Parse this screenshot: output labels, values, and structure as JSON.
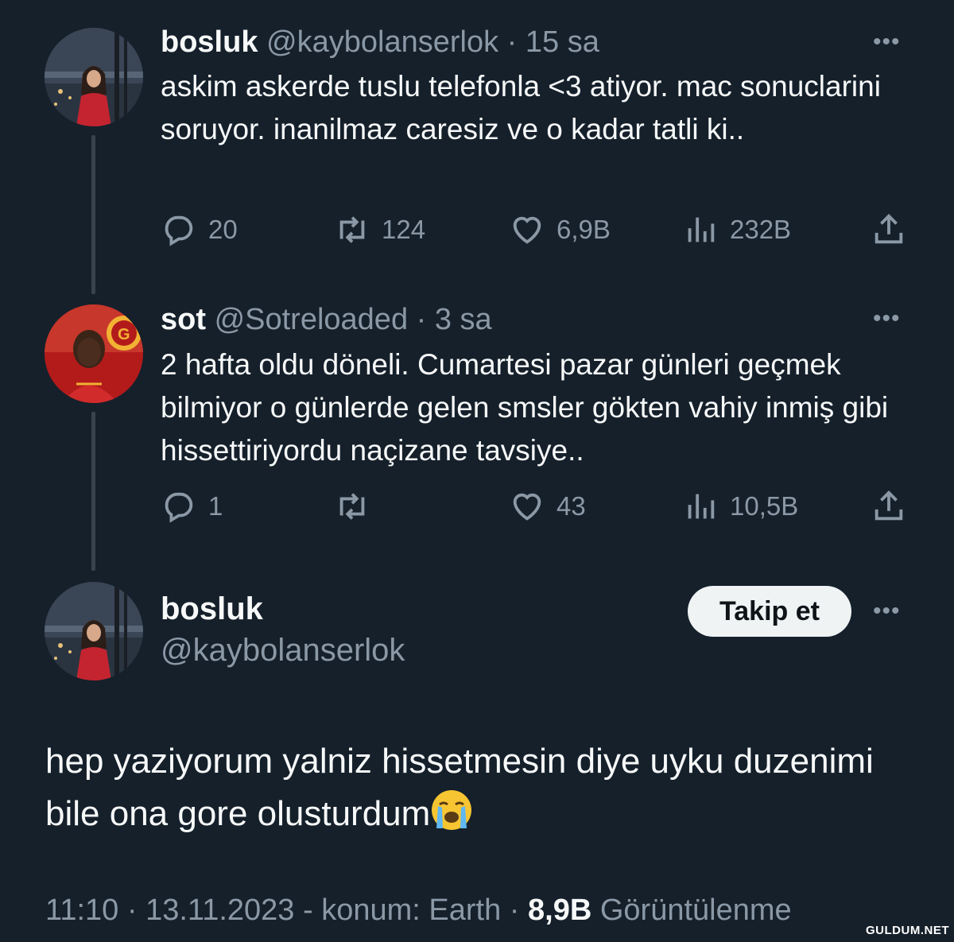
{
  "tweets": [
    {
      "name": "bosluk",
      "handle": "@kaybolanserlok",
      "time": "15 sa",
      "text": "askim askerde tuslu telefonla <3 atiyor. mac sonuclarini soruyor. inanilmaz caresiz ve o kadar tatli ki..",
      "replies": "20",
      "retweets": "124",
      "likes": "6,9B",
      "views": "232B"
    },
    {
      "name": "sot",
      "handle": "@Sotreloaded",
      "time": "3 sa",
      "text": "2 hafta oldu döneli. Cumartesi pazar günleri geçmek bilmiyor o günlerde gelen smsler gökten vahiy inmiş gibi hissettiriyordu naçizane tavsiye..",
      "replies": "1",
      "retweets": "",
      "likes": "43",
      "views": "10,5B"
    }
  ],
  "main_tweet": {
    "name": "bosluk",
    "handle": "@kaybolanserlok",
    "follow_label": "Takip et",
    "text": "hep yaziyorum yalniz hissetmesin diye uyku duzenimi bile ona gore olusturdum",
    "emoji": "loudly-crying-face",
    "time": "11:10",
    "date": "13.11.2023",
    "location": "- konum: Earth",
    "views_count": "8,9B",
    "views_label": "Görüntülenme"
  },
  "more_glyph": "•••",
  "separator": "·",
  "watermark": "GULDUM.NET",
  "colors": {
    "background": "#15202b",
    "text": "#f7f9f9",
    "muted": "#8b98a5",
    "thread_line": "#38444d",
    "follow_button": "#eff3f4"
  }
}
